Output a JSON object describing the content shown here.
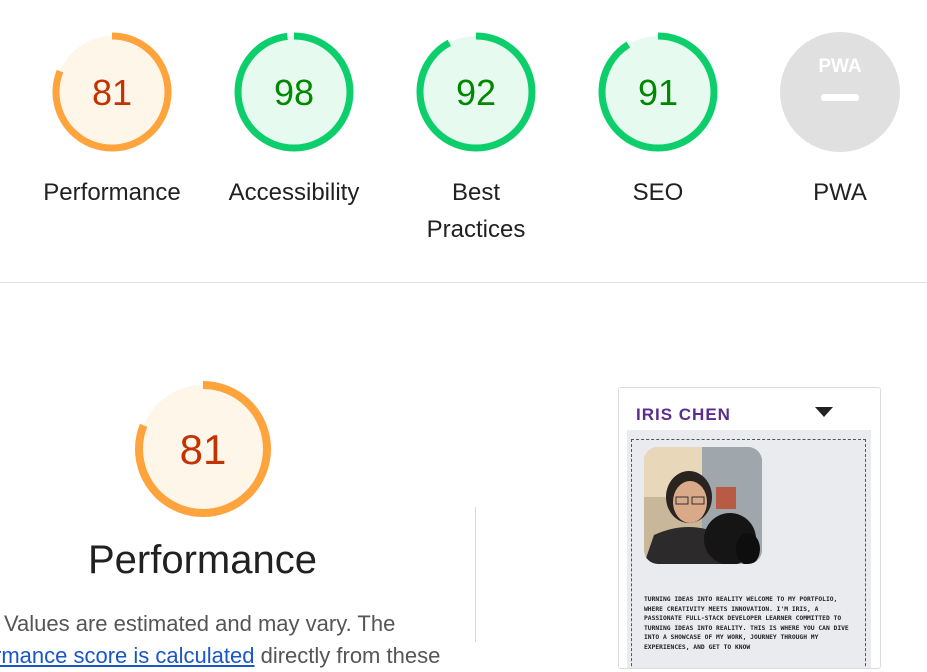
{
  "categories": [
    {
      "label": "Performance",
      "score": "81",
      "value": 81,
      "status": "average"
    },
    {
      "label": "Accessibility",
      "score": "98",
      "value": 98,
      "status": "pass"
    },
    {
      "label": "Best Practices",
      "label_line1": "Best",
      "label_line2": "Practices",
      "score": "92",
      "value": 92,
      "status": "pass"
    },
    {
      "label": "SEO",
      "score": "91",
      "value": 91,
      "status": "pass"
    },
    {
      "label": "PWA",
      "badge": "PWA",
      "status": "na"
    }
  ],
  "colors": {
    "average_ring": "#ffa33c",
    "average_fill": "#fff6ea",
    "average_text": "#c33300",
    "pass_ring": "#0cce6b",
    "pass_fill": "#e6faef",
    "pass_text": "#008800",
    "na_fill": "#e0e0e0"
  },
  "performance_section": {
    "score": "81",
    "value": 81,
    "title": "Performance",
    "desc_line1": "Values are estimated and may vary. The",
    "desc_line2_start": "rmance score is ",
    "desc_line2_link": "calculated",
    "desc_line2_end": " directly from these"
  },
  "preview": {
    "brand": "IRIS CHEN",
    "intro": "Turning ideas into reality Welcome to my portfolio, where creativity meets innovation. I'm Iris, a passionate full-stack developer learner committed to turning ideas into reality. This is where you can dive into a showcase of my work, journey through my experiences, and get to know"
  }
}
